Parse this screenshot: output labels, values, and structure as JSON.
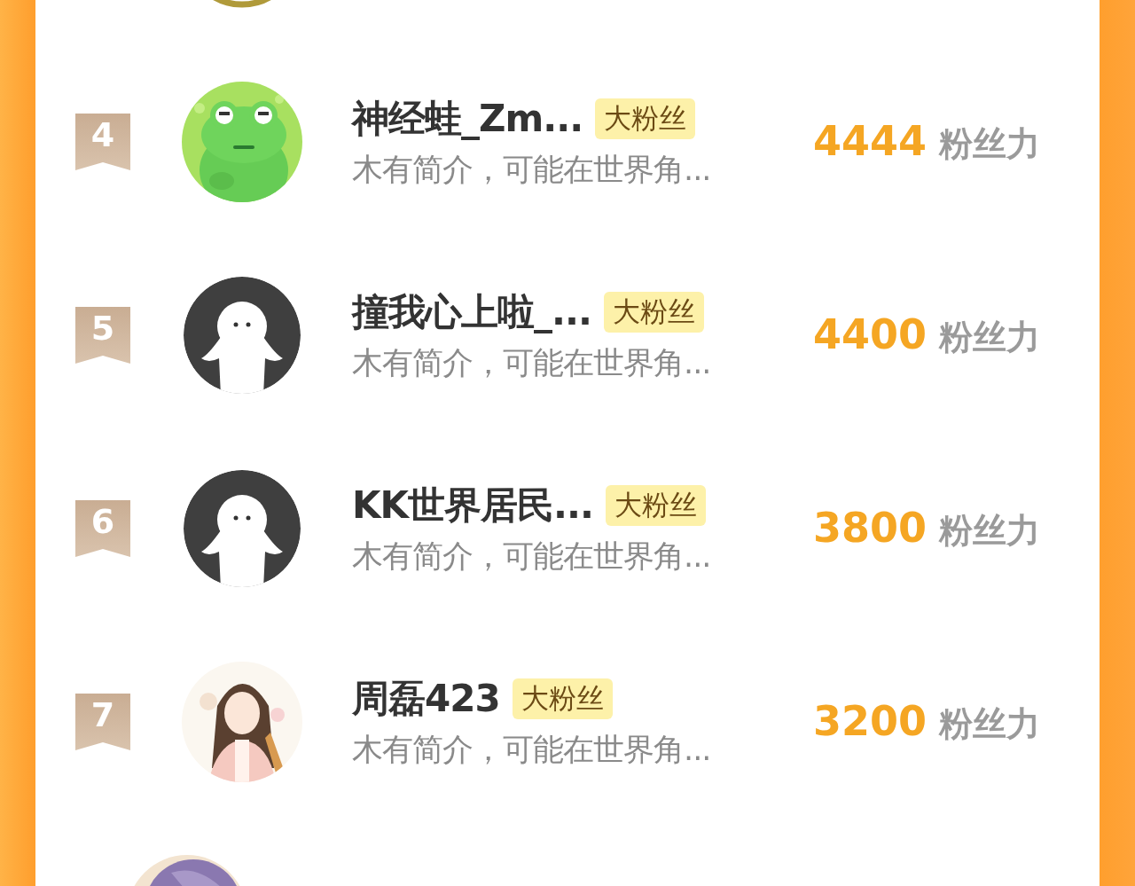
{
  "fans": [
    {
      "rank": "4",
      "name": "神经蛙_Zm...",
      "badge": "大粉丝",
      "intro": "木有简介，可能在世界角...",
      "score": "4444",
      "score_unit": "粉丝力"
    },
    {
      "rank": "5",
      "name": "撞我心上啦_...",
      "badge": "大粉丝",
      "intro": "木有简介，可能在世界角...",
      "score": "4400",
      "score_unit": "粉丝力",
      "avatar": {
        "kind": "default"
      }
    },
    {
      "rank": "6",
      "name": "KK世界居民...",
      "badge": "大粉丝",
      "intro": "木有简介，可能在世界角...",
      "score": "3800",
      "score_unit": "粉丝力",
      "avatar": {
        "kind": "default"
      }
    },
    {
      "rank": "7",
      "name": "周磊423",
      "badge": "大粉丝",
      "intro": "木有简介，可能在世界角...",
      "score": "3200",
      "score_unit": "粉丝力"
    }
  ]
}
